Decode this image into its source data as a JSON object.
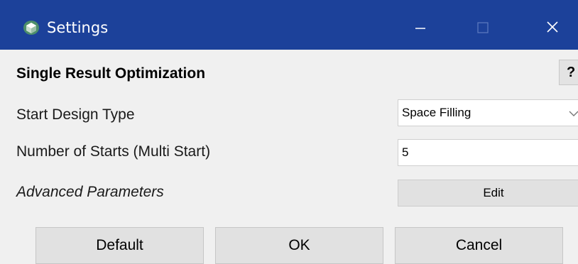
{
  "window": {
    "title": "Settings",
    "title_bar_color": "#1c419a",
    "icons": {
      "app": "app-cube-icon",
      "minimize": "minimize-icon",
      "maximize": "maximize-icon",
      "close": "close-icon"
    }
  },
  "section": {
    "heading": "Single Result Optimization",
    "help_label": "?"
  },
  "fields": {
    "start_design_type": {
      "label": "Start Design Type",
      "value": "Space Filling"
    },
    "number_of_starts": {
      "label": "Number of Starts (Multi Start)",
      "value": "5"
    },
    "advanced_parameters": {
      "label": "Advanced Parameters",
      "button_label": "Edit"
    }
  },
  "footer": {
    "default_label": "Default",
    "ok_label": "OK",
    "cancel_label": "Cancel"
  }
}
